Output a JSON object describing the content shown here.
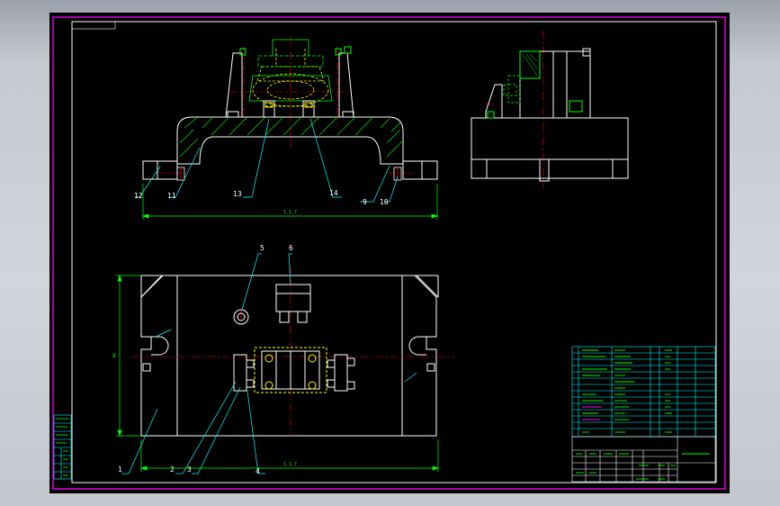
{
  "drawing": {
    "colors": {
      "background": "#000000",
      "frame": "#ff00ff",
      "outline": "#ffffff",
      "dimension": "#00ff00",
      "centerline": "#ff0000",
      "hatch": "#00ff00",
      "hidden": "#ffff00",
      "leader": "#00ffff",
      "title_block": "#00ffff"
    },
    "balloons": {
      "b1": "1",
      "b2": "2",
      "b3": "3",
      "b4": "4",
      "b5": "5",
      "b6": "6",
      "b9": "9",
      "b10": "10",
      "b11": "11",
      "b12": "12",
      "b13": "13",
      "b14": "14"
    },
    "dims": {
      "front_width": "1.1.7",
      "plan_width": "1.1.7",
      "plan_height": "8"
    }
  }
}
